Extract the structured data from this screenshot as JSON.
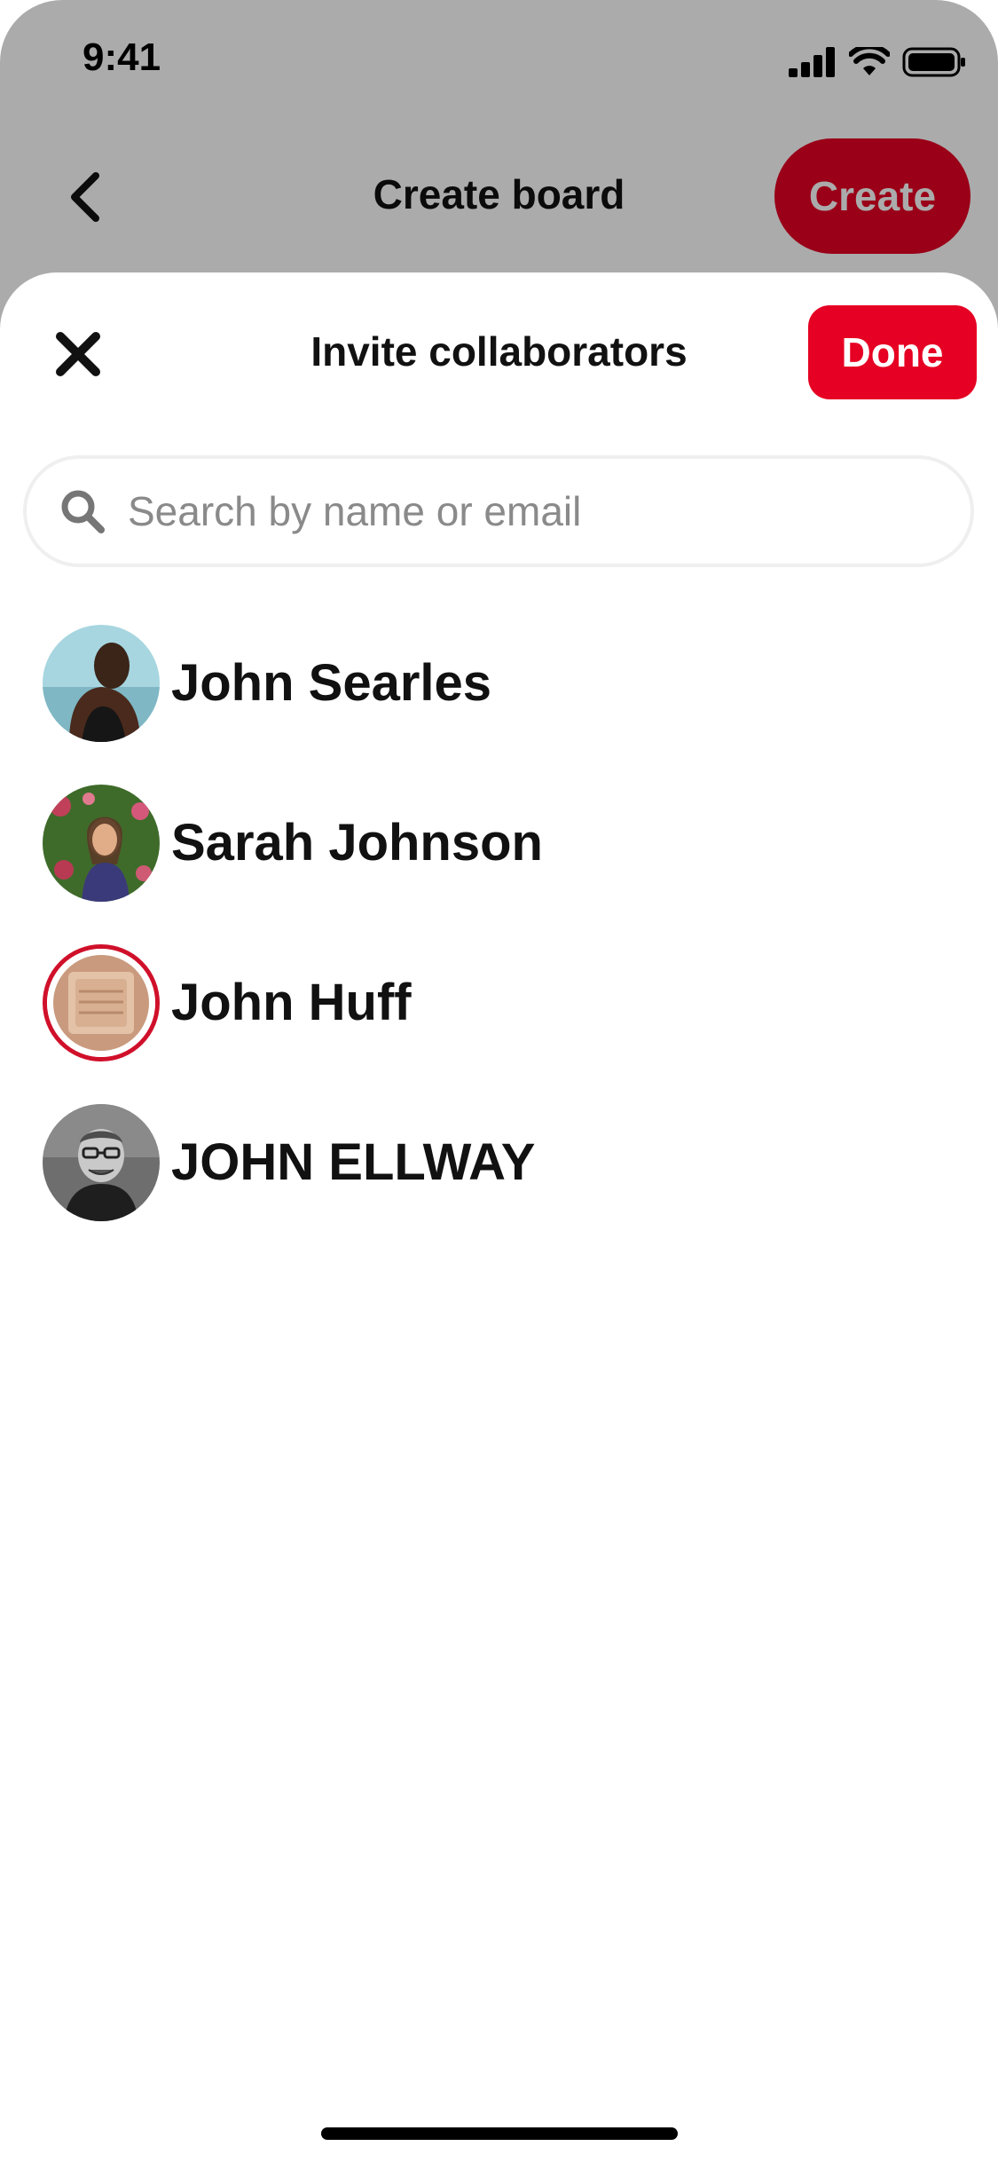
{
  "status_bar": {
    "time": "9:41"
  },
  "background_screen": {
    "title": "Create board",
    "create_label": "Create",
    "accent": "#e60023"
  },
  "sheet": {
    "title": "Invite collaborators",
    "done_label": "Done",
    "close_icon": "close-icon",
    "search": {
      "placeholder": "Search by name or email",
      "value": "",
      "icon": "search-icon"
    },
    "people": [
      {
        "name": "John Searles"
      },
      {
        "name": "Sarah Johnson"
      },
      {
        "name": "John Huff"
      },
      {
        "name": "JOHN ELLWAY"
      }
    ]
  },
  "colors": {
    "accent": "#e60023",
    "text": "#111111",
    "placeholder": "#8a8a8a",
    "search_border": "#efefef"
  }
}
